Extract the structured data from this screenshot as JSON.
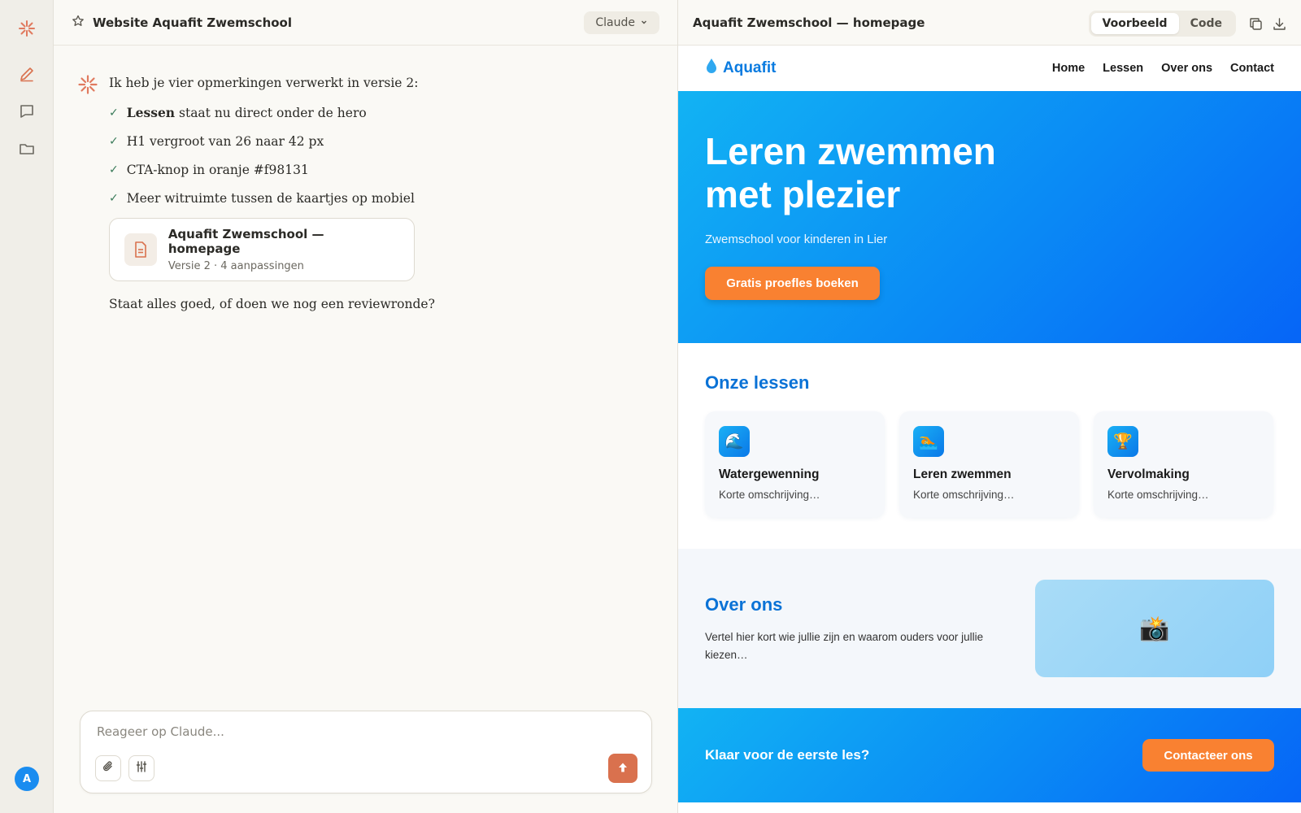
{
  "rail": {
    "logo_icon": "claude-spark-icon",
    "items": [
      "new-chat-icon",
      "chats-icon",
      "projects-icon"
    ],
    "avatar_initial": "A"
  },
  "chat": {
    "title": "Website Aquafit Zwemschool",
    "model": "Claude",
    "message": {
      "intro": "Ik heb je vier opmerkingen verwerkt in versie 2:",
      "checks": [
        {
          "bold": "Lessen",
          "text": " staat nu direct onder de hero"
        },
        {
          "bold": "",
          "text": "H1 vergroot van 26 naar 42 px"
        },
        {
          "bold": "",
          "text": "CTA-knop in oranje #f98131"
        },
        {
          "bold": "",
          "text": "Meer witruimte tussen de kaartjes op mobiel"
        }
      ],
      "artifact": {
        "title": "Aquafit Zwemschool — homepage",
        "subtitle": "Versie 2 · 4 aanpassingen"
      },
      "outro": "Staat alles goed, of doen we nog een reviewronde?"
    },
    "composer": {
      "placeholder": "Reageer op Claude..."
    }
  },
  "preview": {
    "title": "Aquafit Zwemschool — homepage",
    "tabs": {
      "preview": "Voorbeeld",
      "code": "Code"
    },
    "site": {
      "logo": "Aquafit",
      "nav": [
        "Home",
        "Lessen",
        "Over ons",
        "Contact"
      ],
      "hero": {
        "title": "Leren zwemmen met plezier",
        "subtitle": "Zwemschool voor kinderen in Lier",
        "cta": "Gratis proefles boeken"
      },
      "lessons": {
        "title": "Onze lessen",
        "cards": [
          {
            "icon": "🌊",
            "title": "Watergewenning",
            "desc": "Korte omschrijving…"
          },
          {
            "icon": "🏊",
            "title": "Leren zwemmen",
            "desc": "Korte omschrijving…"
          },
          {
            "icon": "🏆",
            "title": "Vervolmaking",
            "desc": "Korte omschrijving…"
          }
        ]
      },
      "about": {
        "title": "Over ons",
        "text": "Vertel hier kort wie jullie zijn en waarom ouders voor jullie kiezen…",
        "image_icon": "📸"
      },
      "footer_cta": {
        "text": "Klaar voor de eerste les?",
        "button": "Contacteer ons"
      }
    }
  },
  "colors": {
    "accent": "#d9714e",
    "brand_blue": "#0a7be0",
    "cta_orange": "#f98131"
  }
}
